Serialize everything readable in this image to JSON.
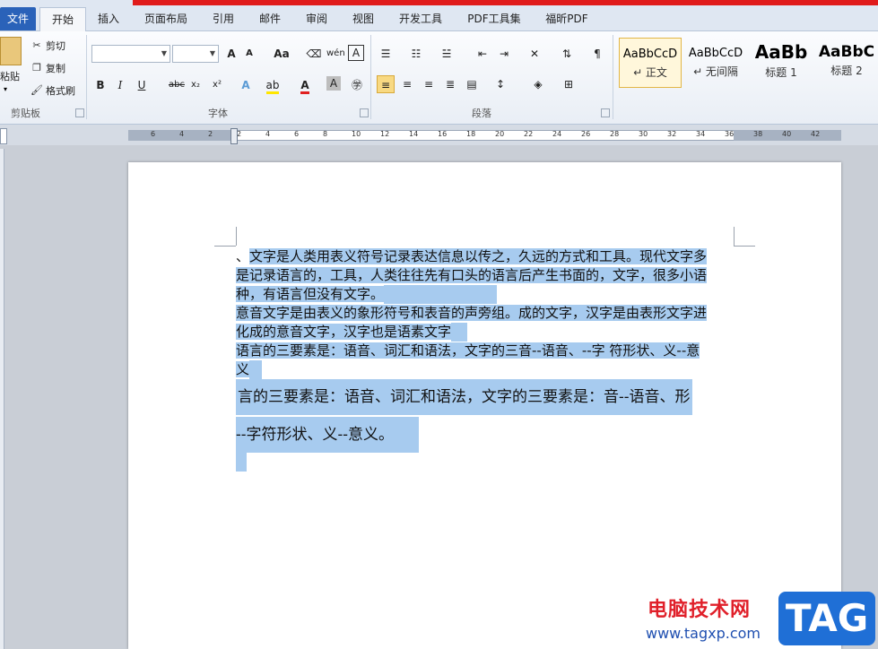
{
  "tabs": [
    "文件",
    "开始",
    "插入",
    "页面布局",
    "引用",
    "邮件",
    "审阅",
    "视图",
    "开发工具",
    "PDF工具集",
    "福昕PDF"
  ],
  "clipboard": {
    "paste": "粘贴",
    "cut": "剪切",
    "copy": "复制",
    "format_painter": "格式刷",
    "label": "剪贴板"
  },
  "font": {
    "label": "字体",
    "name_value": "",
    "size_value": "",
    "grow": "A",
    "shrink": "A",
    "case": "Aa",
    "bold": "B",
    "italic": "I",
    "underline": "U",
    "strike": "abc",
    "subscript": "x₂",
    "superscript": "x²",
    "pinyin": "wén",
    "color_a": "A"
  },
  "paragraph": {
    "label": "段落"
  },
  "styles": [
    {
      "sample": "AaBbCcD",
      "name": "↵ 正文"
    },
    {
      "sample": "AaBbCcD",
      "name": "↵ 无间隔"
    },
    {
      "sample": "AaBb",
      "name": "标题 1"
    },
    {
      "sample": "AaBbC",
      "name": "标题 2"
    }
  ],
  "ruler_ticks": [
    "6",
    "4",
    "2",
    "2",
    "4",
    "6",
    "8",
    "10",
    "12",
    "14",
    "16",
    "18",
    "20",
    "22",
    "24",
    "26",
    "28",
    "30",
    "32",
    "34",
    "36",
    "38",
    "40",
    "42"
  ],
  "document": {
    "lines": [
      "、文字是人类用表义符号记录表达信息以传之，久远的方式和工具。现代文字多",
      "是记录语言的，工具，人类往往先有口头的语言后产生书面的，文字，很多小语",
      "种，有语言但没有文字。",
      "意音文字是由表义的象形符号和表音的声旁组。成的文字，汉字是由表形文字进",
      "化成的意音文字，汉字也是语素文字",
      "语言的三要素是：语音、词汇和语法，文字的三音--语音、--字  符形状、义--意",
      "义",
      "言的三要素是：语音、词汇和语法，文字的三要素是：音--语音、形",
      "--字符形状、义--意义。"
    ]
  },
  "watermark": {
    "site_name": "电脑技术网",
    "url": "www.tagxp.com",
    "tag": "TAG"
  }
}
